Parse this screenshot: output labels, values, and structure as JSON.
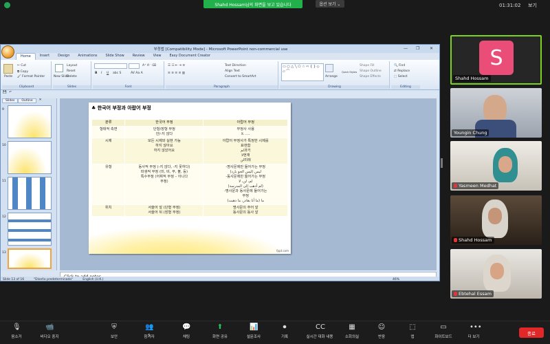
{
  "zoom": {
    "share_banner": "Shahd Hossam님의 화면을 보고 있습니다",
    "view_options": "옵션 보기 ⌄",
    "clock": "01:31:02",
    "view": "보기",
    "toolbar": [
      {
        "label": "음소거",
        "icon": "mic-icon"
      },
      {
        "label": "비디오 중지",
        "icon": "video-icon"
      },
      {
        "label": "보안",
        "icon": "shield-icon"
      },
      {
        "label": "참가자",
        "icon": "participants-icon",
        "count": "5"
      },
      {
        "label": "채팅",
        "icon": "chat-icon"
      },
      {
        "label": "화면 공유",
        "icon": "share-icon"
      },
      {
        "label": "설문조사",
        "icon": "poll-icon"
      },
      {
        "label": "기록",
        "icon": "record-icon"
      },
      {
        "label": "실시간 대화 내용",
        "icon": "cc-icon"
      },
      {
        "label": "소회의실",
        "icon": "breakout-icon"
      },
      {
        "label": "반응",
        "icon": "reaction-icon"
      },
      {
        "label": "앱",
        "icon": "apps-icon"
      },
      {
        "label": "화이트보드",
        "icon": "whiteboard-icon"
      },
      {
        "label": "더 보기",
        "icon": "more-icon"
      }
    ],
    "end_label": "종료",
    "participants": [
      {
        "name": "Shahd Hossam",
        "initial": "S",
        "active": true,
        "muted": false
      },
      {
        "name": "Youngin Chung",
        "active": false,
        "muted": false
      },
      {
        "name": "Yasmeen Medhat",
        "active": false,
        "muted": true
      },
      {
        "name": "Shahd Hossam",
        "active": false,
        "muted": true
      },
      {
        "name": "Ebtehal Essam",
        "active": false,
        "muted": true
      }
    ]
  },
  "ppt": {
    "title": "부정법 [Compatibility Mode] - Microsoft PowerPoint non-commercial use",
    "tabs": [
      "Home",
      "Insert",
      "Design",
      "Animations",
      "Slide Show",
      "Review",
      "View",
      "Easy Document Creator"
    ],
    "active_tab": "Home",
    "groups": {
      "clipboard": {
        "label": "Clipboard",
        "paste": "Paste",
        "cut": "Cut",
        "copy": "Copy",
        "format_painter": "Format Painter"
      },
      "slides": {
        "label": "Slides",
        "new_slide": "New Slide",
        "layout": "Layout",
        "reset": "Reset",
        "delete": "Delete"
      },
      "font": {
        "label": "Font"
      },
      "paragraph": {
        "label": "Paragraph",
        "text_direction": "Text Direction",
        "align_text": "Align Text",
        "convert": "Convert to SmartArt"
      },
      "drawing": {
        "label": "Drawing",
        "arrange": "Arrange",
        "quick_styles": "Quick Styles",
        "shape_fill": "Shape Fill",
        "shape_outline": "Shape Outline",
        "shape_effects": "Shape Effects"
      },
      "editing": {
        "label": "Editing",
        "find": "Find",
        "replace": "Replace",
        "select": "Select"
      }
    },
    "panel_tabs": [
      "Slides",
      "Outline"
    ],
    "thumb_numbers": [
      "9",
      "10",
      "11",
      "12",
      "13"
    ],
    "notes_placeholder": "Click to add notes",
    "status": {
      "slide": "Slide 13 of 16",
      "theme": "\"Diseño predeterminado\"",
      "language": "English (U.K.)",
      "zoom": "46%"
    },
    "slide": {
      "title": "한국어 부정과 아랍어 부정",
      "headers": [
        "분류",
        "한국어 부정",
        "아랍어 부정"
      ],
      "rows": [
        [
          "형태적 측면",
          "단형/장형 부정\n안/-지 않다",
          "부정사 사용\nلا، ...."
        ],
        [
          "시제",
          "모든 시제와 실현 가능\n하지 않아요\n하지 않았어요",
          "아랍어 부정사가 특정한 시제를\n표현함\nلم과거\nلا현재\nلن미래"
        ],
        [
          "유형",
          "동사적 부정 (-지 않다, -지 못하다)\n파생적 부정 (미, 비, 무, 불, 등)\n특수부정 (어휘적 부정 – 아니다\n부정)",
          "-명사문에만 들어가는 부정\nليس (ليس الجو بارد)\n-동사문에만 들어가는 부정\nلم، لن، لا\n(لم أذهب إلى المدرسة)\n-명사문과 동사문에 들어가는\n부정\nما (ما أنا بقادر، ما ذهبت)"
        ],
        [
          "위치",
          "서술어 앞 (단형 부정)\n서술어 뒤 (장형 부정)",
          "명사문의 주어 앞\n동사문의 동사 앞"
        ]
      ],
      "footer": "fppt.com"
    }
  }
}
